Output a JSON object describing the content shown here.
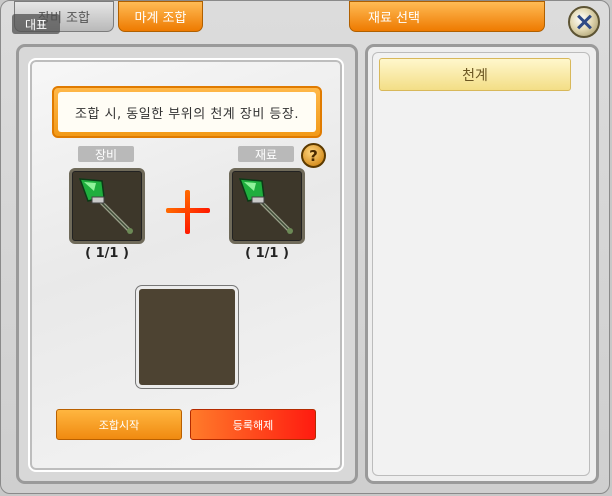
{
  "tabs": {
    "equipment_combine": "장비 조합",
    "magic_combine": "마계 조합",
    "material_select": "재료 선택"
  },
  "badge": "대표",
  "notice": "조합 시, 동일한 부위의 천계 장비 등장.",
  "slots": {
    "equipment_label": "장비",
    "material_label": "재료",
    "equipment_count": "( 1/1 )",
    "material_count": "( 1/1 )",
    "item_icon": "green-scepter-icon"
  },
  "help_icon": "?",
  "buttons": {
    "start": "조합시작",
    "cancel": "등록해제"
  },
  "material_list": [
    "천계"
  ],
  "colors": {
    "accent_orange": "#f08a10",
    "cancel_red": "#ff1b10",
    "selected_item": "#f3de86"
  }
}
